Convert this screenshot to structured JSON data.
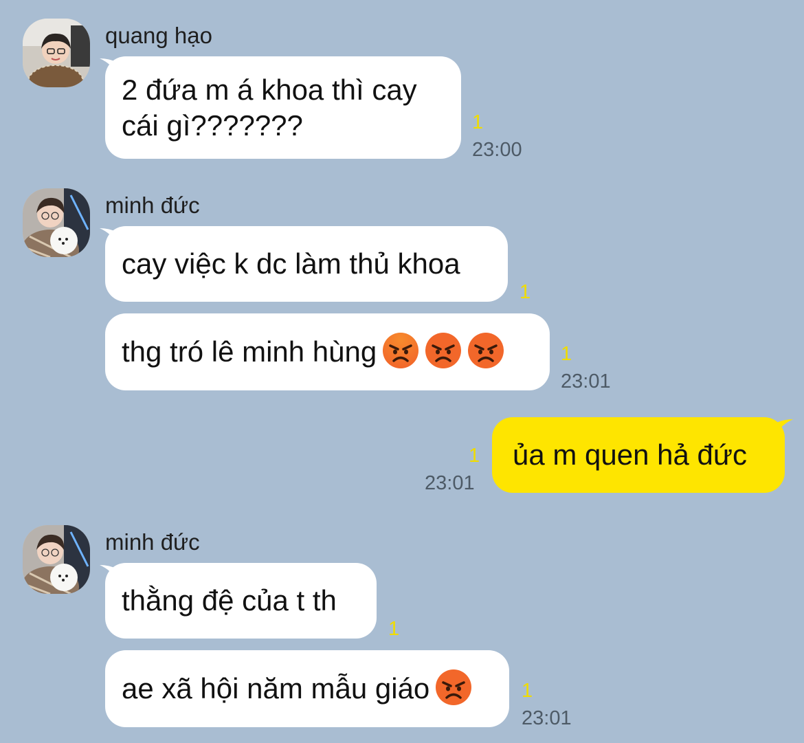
{
  "messages": [
    {
      "sender": "quang hạo",
      "bubbles": [
        {
          "text": "2 đứa m á khoa thì cay cái gì???????",
          "read_count": "1"
        }
      ],
      "time": "23:00"
    },
    {
      "sender": "minh đức",
      "bubbles": [
        {
          "text": "cay việc k dc làm thủ khoa",
          "read_count": "1"
        },
        {
          "text": "thg tró lê minh hùng",
          "emojis": [
            "angry-face-emoji",
            "angry-face-emoji",
            "angry-face-emoji"
          ],
          "read_count": "1"
        }
      ],
      "time": "23:01"
    },
    {
      "sender": "me",
      "bubbles": [
        {
          "text": "ủa m quen hả đức",
          "read_count": "1"
        }
      ],
      "time": "23:01"
    },
    {
      "sender": "minh đức",
      "bubbles": [
        {
          "text": "thằng đệ của t th",
          "read_count": "1"
        },
        {
          "text": "ae xã hội năm mẫu giáo",
          "emojis": [
            "angry-face-emoji"
          ],
          "read_count": "1"
        }
      ],
      "time": "23:01"
    }
  ],
  "colors": {
    "background": "#a9bdd2",
    "incoming_bubble": "#ffffff",
    "outgoing_bubble": "#fee500",
    "read_count": "#f0dc00",
    "timestamp": "#4d5a66"
  }
}
